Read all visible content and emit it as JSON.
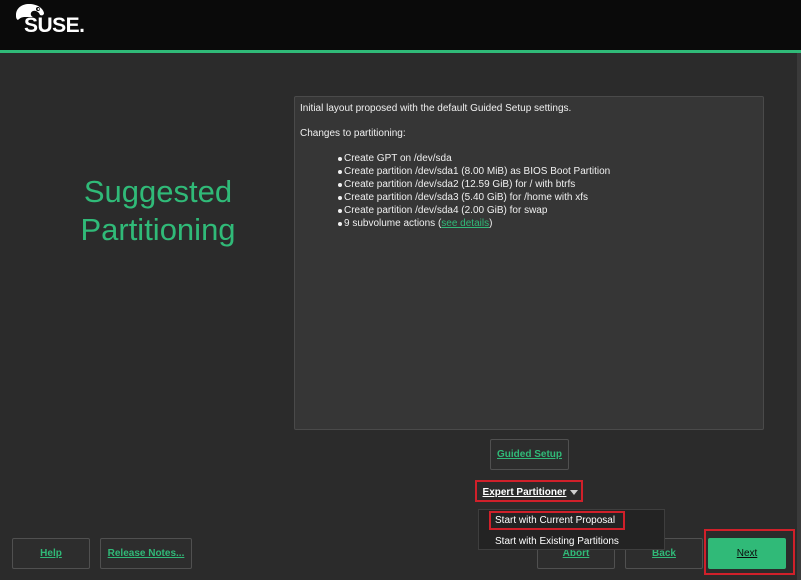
{
  "brand": {
    "logo_text": "SUSE."
  },
  "page": {
    "title_line1": "Suggested",
    "title_line2": "Partitioning"
  },
  "summary": {
    "intro": "Initial layout proposed with the default Guided Setup settings.",
    "changes_label": "Changes to partitioning:",
    "items": [
      "Create GPT on /dev/sda",
      "Create partition /dev/sda1 (8.00 MiB) as BIOS Boot Partition",
      "Create partition /dev/sda2 (12.59 GiB) for / with btrfs",
      "Create partition /dev/sda3 (5.40 GiB) for /home with xfs",
      "Create partition /dev/sda4 (2.00 GiB) for swap"
    ],
    "subvolume_prefix": "9 subvolume actions (",
    "subvolume_link": "see details",
    "subvolume_suffix": ")"
  },
  "buttons": {
    "guided_setup": "Guided Setup",
    "expert_partitioner": "Expert Partitioner",
    "help": "Help",
    "release_notes": "Release Notes...",
    "abort": "Abort",
    "back": "Back",
    "next": "Next"
  },
  "dropdown": {
    "items": [
      "Start with Current Proposal",
      "Start with Existing Partitions"
    ]
  },
  "colors": {
    "accent": "#30ba78",
    "highlight": "#d0202a",
    "background": "#2b2b2b",
    "topbar": "#0a0a0a"
  }
}
